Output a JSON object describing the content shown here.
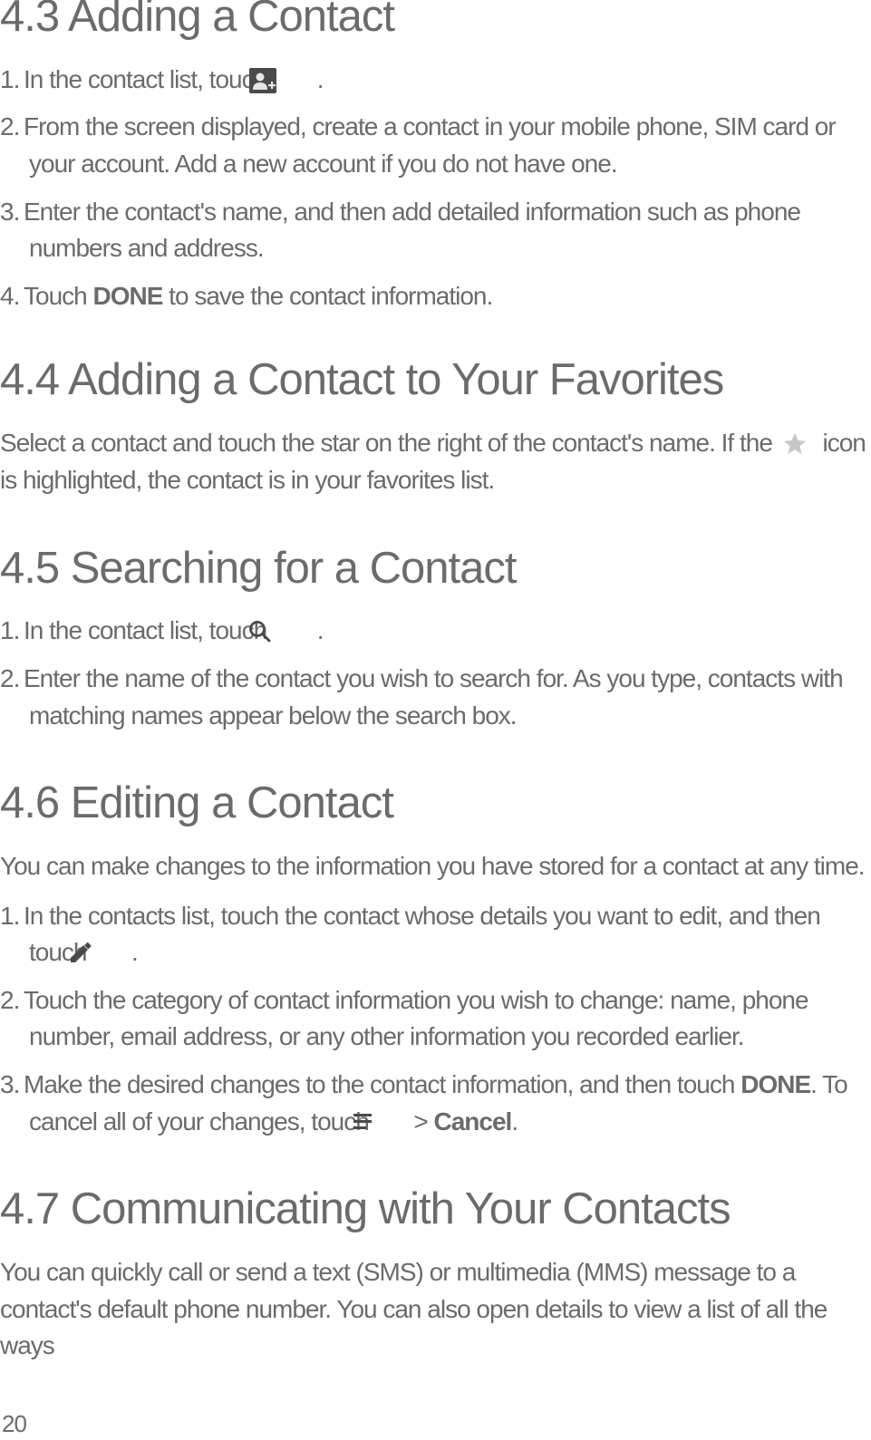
{
  "page_number": "20",
  "sections": {
    "s43": {
      "heading": "4.3  Adding a Contact",
      "steps": {
        "1a": "In the contact list, touch ",
        "1b": " .",
        "2": "From the screen displayed, create a contact in your mobile phone, SIM card or your account. Add a new account if you do not have one.",
        "3": "Enter the contact's name, and then add detailed information such as phone numbers and address.",
        "4a": "Touch ",
        "4_done": "DONE",
        "4b": " to save the contact information."
      }
    },
    "s44": {
      "heading": "4.4  Adding a Contact to Your Favorites",
      "para_a": "Select a contact and touch the star on the right of the contact's name. If the ",
      "para_b": " icon is highlighted, the contact is in your favorites list."
    },
    "s45": {
      "heading": "4.5  Searching for a Contact",
      "steps": {
        "1a": "In the contact list, touch ",
        "1b": " .",
        "2": "Enter the name of the contact you wish to search for. As you type, contacts with matching names appear below the search box."
      }
    },
    "s46": {
      "heading": "4.6  Editing a Contact",
      "intro": "You can make changes to the information you have stored for a contact at any time.",
      "steps": {
        "1a": "In the contacts list, touch the contact whose details you want to edit, and then touch ",
        "1b": " .",
        "2": "Touch the category of contact information you wish to change: name, phone number, email address, or any other information you recorded earlier.",
        "3a": "Make the desired changes to the contact information, and then touch ",
        "3_done": "DONE",
        "3b": ". To cancel all of your changes, touch ",
        "3c": " > ",
        "3_cancel": "Cancel",
        "3d": "."
      }
    },
    "s47": {
      "heading": "4.7  Communicating with Your Contacts",
      "para": "You can quickly call or send a text (SMS) or multimedia (MMS) message to a contact's default phone number. You can also open details to view a list of all the ways"
    }
  }
}
